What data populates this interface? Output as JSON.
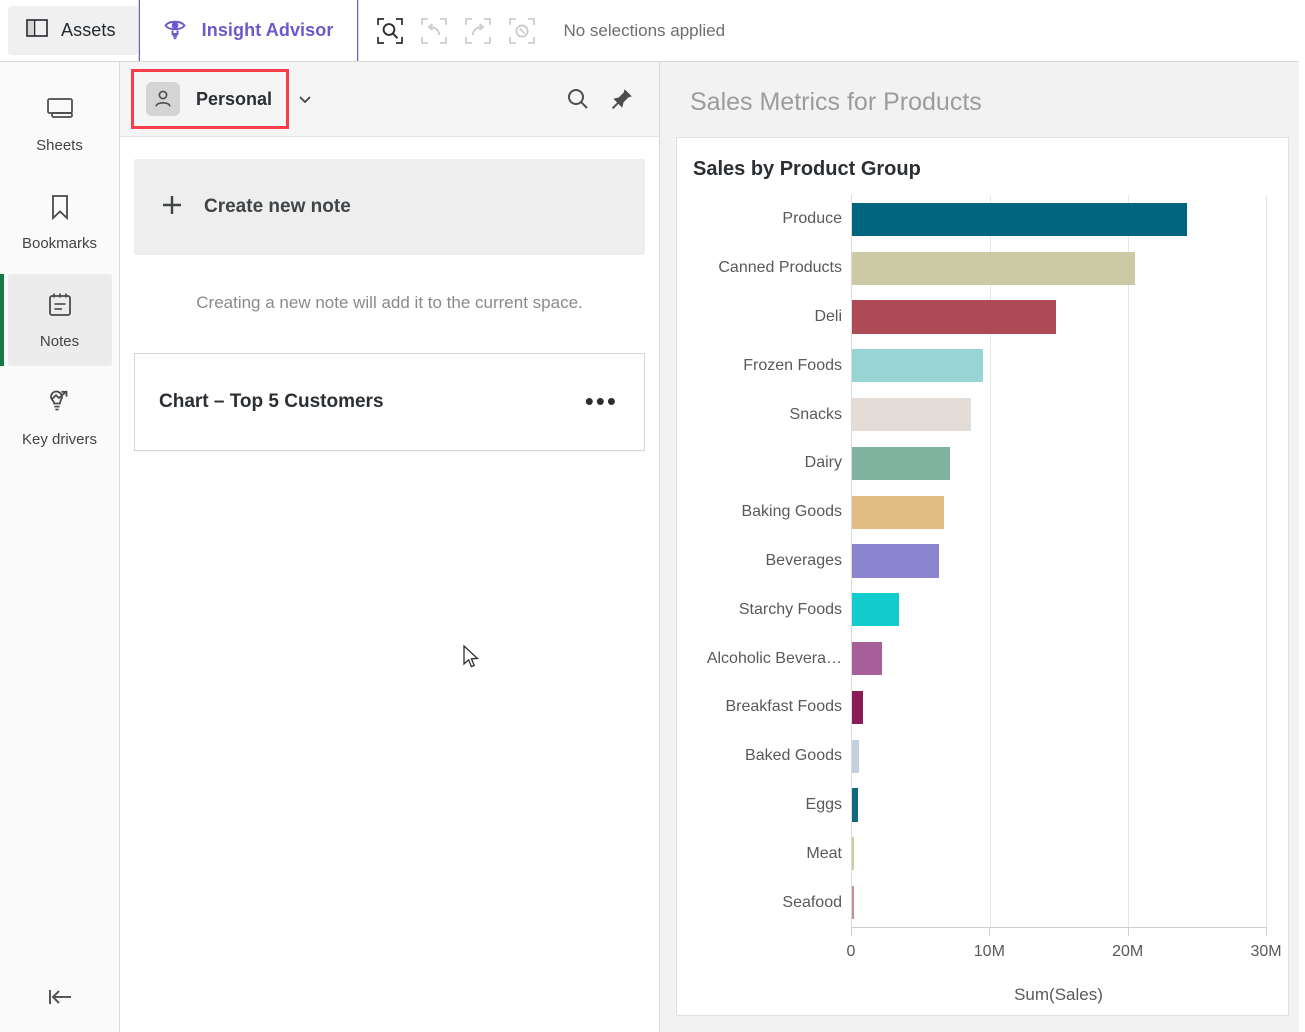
{
  "topbar": {
    "assets_label": "Assets",
    "assets_icon": "panel-layout-icon",
    "insight_advisor_label": "Insight Advisor",
    "insight_advisor_icon": "lightbulb-eye-icon",
    "insight_advisor_color": "#6a5acd",
    "tools": [
      {
        "name": "smart-search-icon",
        "label": "Smart search",
        "enabled": true
      },
      {
        "name": "undo-icon",
        "label": "Step back",
        "enabled": false
      },
      {
        "name": "redo-icon",
        "label": "Step forward",
        "enabled": false
      },
      {
        "name": "clear-selections-icon",
        "label": "Clear all selections",
        "enabled": false
      }
    ],
    "selection_message": "No selections applied"
  },
  "rail": {
    "items": [
      {
        "label": "Sheets",
        "icon": "sheet-icon",
        "active": false
      },
      {
        "label": "Bookmarks",
        "icon": "bookmark-icon",
        "active": false
      },
      {
        "label": "Notes",
        "icon": "notes-icon",
        "active": true
      },
      {
        "label": "Key drivers",
        "icon": "key-drivers-icon",
        "active": false
      }
    ],
    "active_accent_color": "#177a44",
    "collapse_icon": "collapse-left-icon"
  },
  "notes": {
    "space_name": "Personal",
    "space_avatar_icon": "person-icon",
    "space_caret_icon": "chevron-down-icon",
    "highlight_color": "#fa3c4b",
    "search_icon": "search-icon",
    "pin_icon": "pin-icon",
    "create_label": "Create new note",
    "create_icon": "plus-icon",
    "hint": "Creating a new note will add it to the current space.",
    "cards": [
      {
        "title": "Chart – Top 5 Customers",
        "menu_icon": "ellipsis-icon",
        "menu_label": "•••"
      }
    ]
  },
  "chart_panel": {
    "header_title": "Sales Metrics for Products"
  },
  "chart_data": {
    "type": "bar",
    "orientation": "horizontal",
    "title": "Sales by Product Group",
    "xlabel": "Sum(Sales)",
    "ylabel": "",
    "xlim": [
      0,
      30000000
    ],
    "xticks": [
      0,
      10000000,
      20000000,
      30000000
    ],
    "xtick_labels": [
      "0",
      "10M",
      "20M",
      "30M"
    ],
    "grid": true,
    "legend": false,
    "categories": [
      "Produce",
      "Canned Products",
      "Deli",
      "Frozen Foods",
      "Snacks",
      "Dairy",
      "Baking Goods",
      "Beverages",
      "Starchy Foods",
      "Alcoholic Bevera…",
      "Breakfast Foods",
      "Baked Goods",
      "Eggs",
      "Meat",
      "Seafood"
    ],
    "values": [
      24300000,
      20500000,
      14800000,
      9500000,
      8600000,
      7100000,
      6700000,
      6300000,
      3400000,
      2200000,
      800000,
      500000,
      400000,
      130000,
      130000
    ],
    "colors": [
      "#006680",
      "#ccc9a5",
      "#ae4a55",
      "#99d4d4",
      "#e3dcd7",
      "#7fb3a0",
      "#e2bd83",
      "#8a84ce",
      "#11cbcc",
      "#a75f99",
      "#8c1c55",
      "#c3cfdb",
      "#126780",
      "#cbcc9f",
      "#c98b8f"
    ]
  }
}
